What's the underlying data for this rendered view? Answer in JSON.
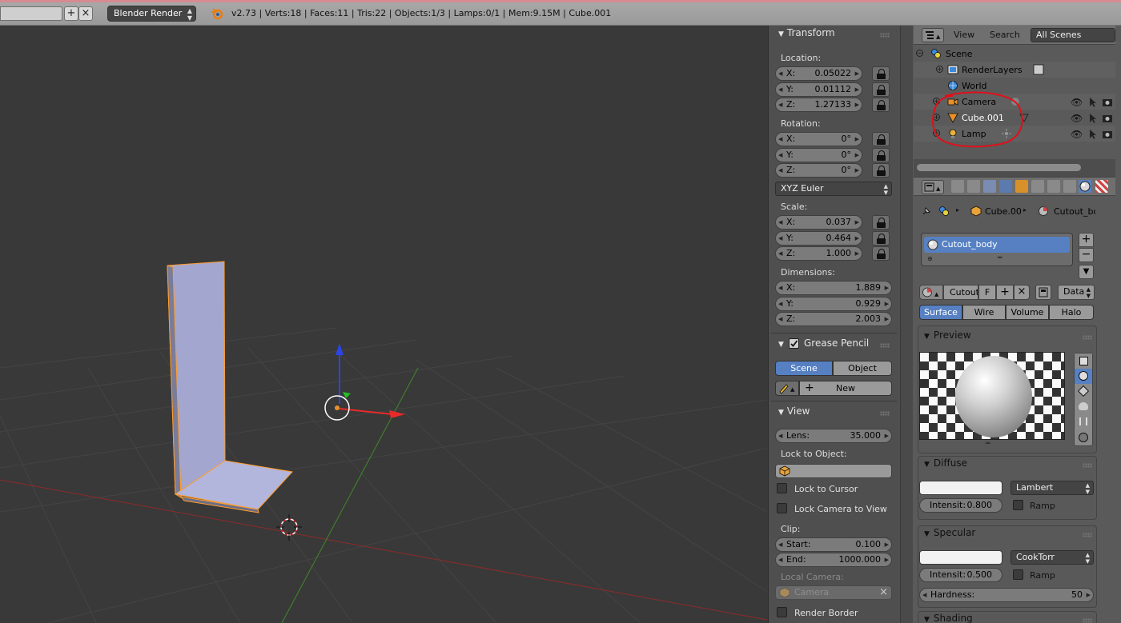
{
  "header": {
    "render_engine": "Blender Render",
    "stats": "v2.73 | Verts:18 | Faces:11 | Tris:22 | Objects:1/3 | Lamps:0/1 | Mem:9.15M | Cube.001"
  },
  "npanel": {
    "transform": {
      "title": "Transform",
      "location_label": "Location:",
      "location": [
        {
          "axis": "X:",
          "value": "0.05022"
        },
        {
          "axis": "Y:",
          "value": "0.01112"
        },
        {
          "axis": "Z:",
          "value": "1.27133"
        }
      ],
      "rotation_label": "Rotation:",
      "rotation": [
        {
          "axis": "X:",
          "value": "0°"
        },
        {
          "axis": "Y:",
          "value": "0°"
        },
        {
          "axis": "Z:",
          "value": "0°"
        }
      ],
      "rotation_mode": "XYZ Euler",
      "scale_label": "Scale:",
      "scale": [
        {
          "axis": "X:",
          "value": "0.037"
        },
        {
          "axis": "Y:",
          "value": "0.464"
        },
        {
          "axis": "Z:",
          "value": "1.000"
        }
      ],
      "dimensions_label": "Dimensions:",
      "dimensions": [
        {
          "axis": "X:",
          "value": "1.889"
        },
        {
          "axis": "Y:",
          "value": "0.929"
        },
        {
          "axis": "Z:",
          "value": "2.003"
        }
      ]
    },
    "grease_pencil": {
      "title": "Grease Pencil",
      "scene_tab": "Scene",
      "object_tab": "Object",
      "new_label": "New"
    },
    "view": {
      "title": "View",
      "lens_label": "Lens:",
      "lens_value": "35.000",
      "lock_to_object_label": "Lock to Object:",
      "lock_to_cursor": "Lock to Cursor",
      "lock_camera_to_view": "Lock Camera to View",
      "clip_label": "Clip:",
      "clip_start_label": "Start:",
      "clip_start": "0.100",
      "clip_end_label": "End:",
      "clip_end": "1000.000",
      "local_camera_label": "Local Camera:",
      "local_camera_value": "Camera",
      "render_border": "Render Border"
    }
  },
  "outliner": {
    "view_menu": "View",
    "search_menu": "Search",
    "scenes_dropdown": "All Scenes",
    "items": [
      {
        "label": "Scene"
      },
      {
        "label": "RenderLayers"
      },
      {
        "label": "World"
      },
      {
        "label": "Camera"
      },
      {
        "label": "Cube.001"
      },
      {
        "label": "Lamp"
      }
    ]
  },
  "properties": {
    "breadcrumb_object": "Cube.00",
    "breadcrumb_material": "Cutout_bo",
    "material_slot": "Cutout_body",
    "material_name": "Cutout",
    "fake_user": "F",
    "link_dropdown": "Data",
    "tabs": [
      "Surface",
      "Wire",
      "Volume",
      "Halo"
    ],
    "preview_title": "Preview",
    "diffuse": {
      "title": "Diffuse",
      "shader": "Lambert",
      "intensity_label": "Intensit:",
      "intensity": "0.800",
      "ramp": "Ramp"
    },
    "specular": {
      "title": "Specular",
      "shader": "CookTorr",
      "intensity_label": "Intensit:",
      "intensity": "0.500",
      "ramp": "Ramp",
      "hardness_label": "Hardness:",
      "hardness": "50"
    },
    "shading_title": "Shading"
  },
  "colors": {
    "selection_blue": "#5680c2",
    "annotation_red": "#e0101a",
    "active_object": "#ffa020"
  }
}
